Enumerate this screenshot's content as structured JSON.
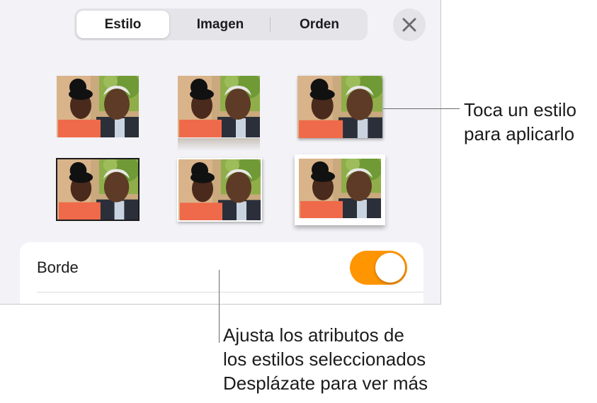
{
  "tabs": [
    {
      "label": "Estilo",
      "active": true
    },
    {
      "label": "Imagen",
      "active": false
    },
    {
      "label": "Orden",
      "active": false
    }
  ],
  "close_icon": "close-icon",
  "styles_grid": {
    "rows": 2,
    "columns": 3,
    "thumbnail_content": "photo-thumbnail"
  },
  "border_row": {
    "label": "Borde",
    "toggle_on": true
  },
  "callouts": {
    "styles": [
      "Toca un estilo",
      "para aplicarlo"
    ],
    "attributes": [
      "Ajusta los atributos de",
      "los estilos seleccionados",
      "Desplázate para ver más"
    ]
  },
  "colors": {
    "accent": "#ff9500",
    "panel_bg": "#f2f2f7",
    "segment_bg": "#e4e4e9",
    "callout_line": "#6b6b6b"
  }
}
